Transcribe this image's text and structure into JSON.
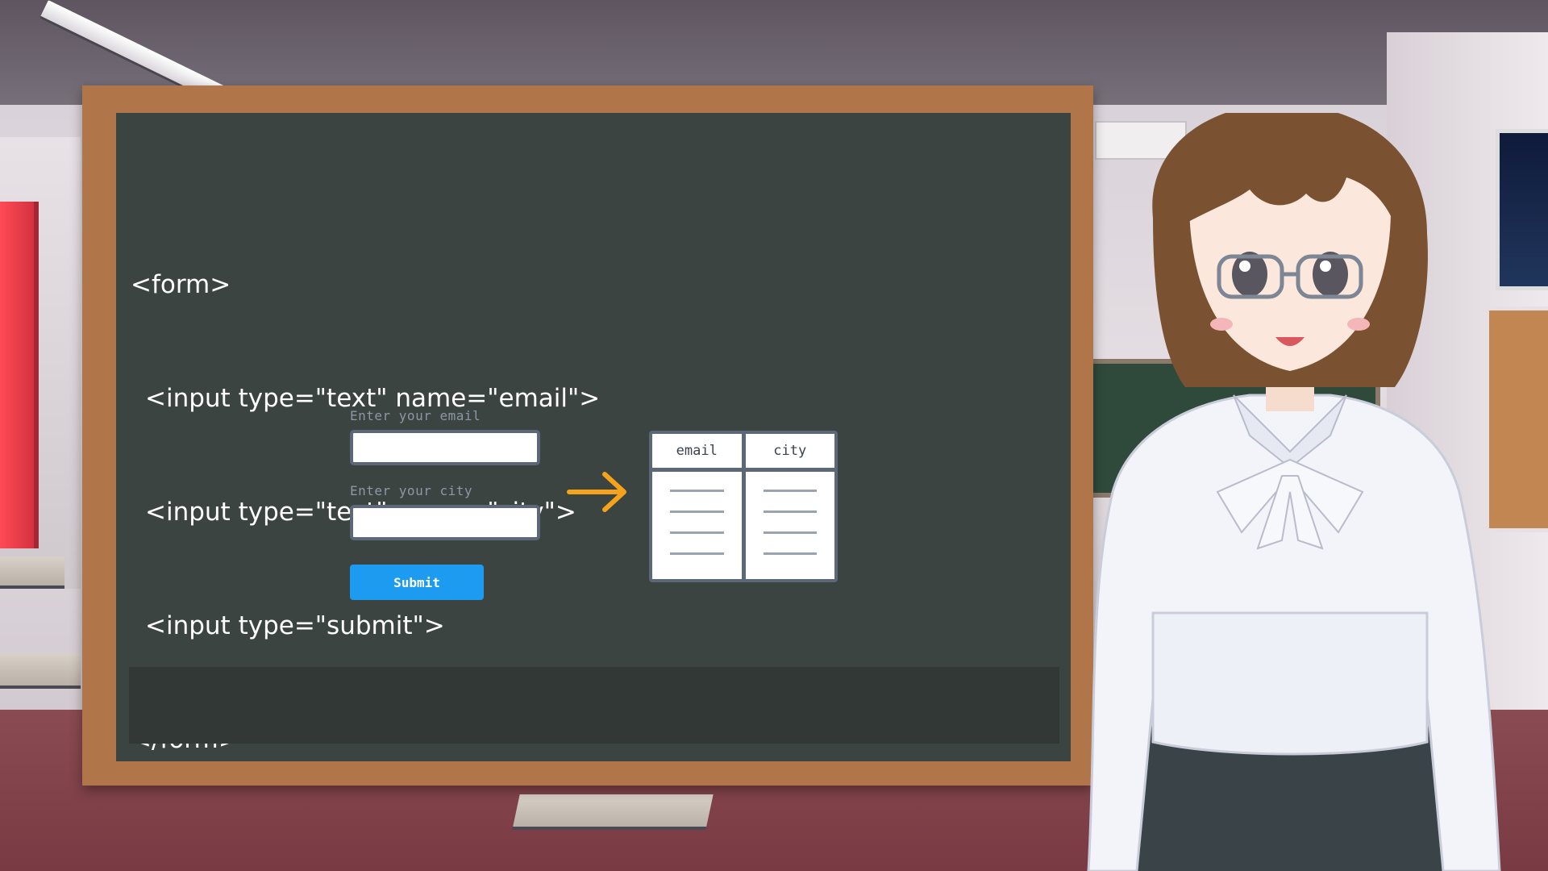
{
  "board": {
    "code_lines": [
      "<form>",
      "<input type=\"text\" name=\"email\">",
      "<input type=\"text\" name=\"city\">",
      "<input type=\"submit\">",
      "</form>"
    ],
    "form": {
      "email_label": "Enter your email",
      "email_value": "",
      "city_label": "Enter your city",
      "city_value": "",
      "submit_label": "Submit"
    },
    "arrow_icon": "arrow-right-icon",
    "table": {
      "headers": [
        "email",
        "city"
      ],
      "row_count": 4
    },
    "caption": ""
  },
  "colors": {
    "board": "#3b4440",
    "frame": "#b07549",
    "submit": "#1c9bf0",
    "arrow": "#f5a31a",
    "table_border": "#5c6778"
  },
  "character": {
    "icon": "teacher-avatar"
  }
}
